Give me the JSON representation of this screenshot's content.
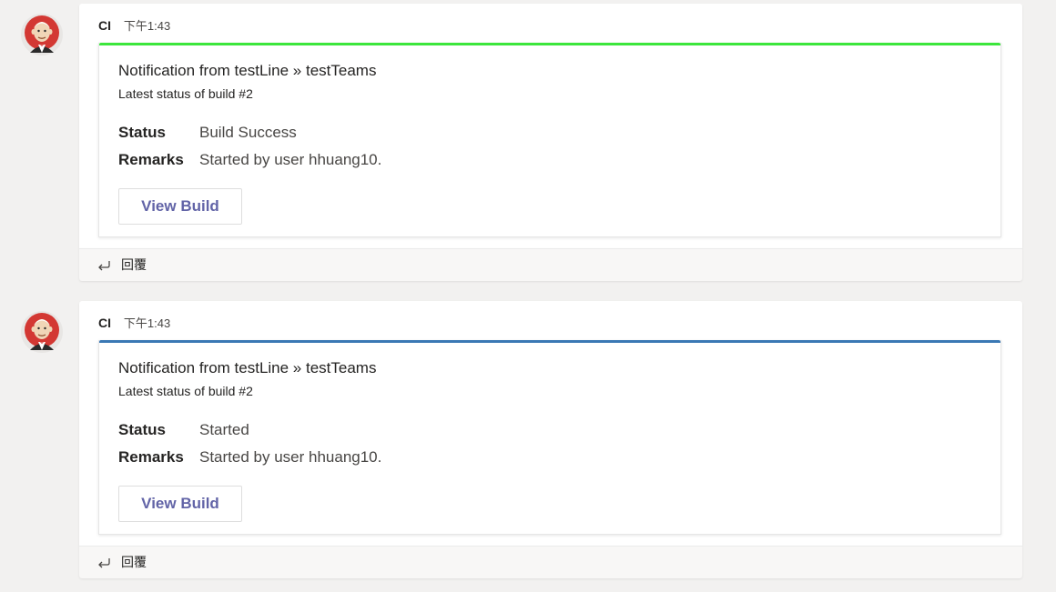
{
  "colors": {
    "success_accent": "#3ce63c",
    "started_accent": "#3a78b4",
    "button_text": "#6264a7"
  },
  "messages": [
    {
      "sender": "CI",
      "time": "下午1:43",
      "accent_color": "#3ce63c",
      "card": {
        "title": "Notification from testLine » testTeams",
        "subtitle": "Latest status of build #2",
        "facts": [
          {
            "label": "Status",
            "value": "Build Success"
          },
          {
            "label": "Remarks",
            "value": "Started by user hhuang10."
          }
        ],
        "button_label": "View Build"
      },
      "reply_label": "回覆",
      "avatar_icon": "jenkins-butler-icon",
      "reply_icon": "reply-arrow-icon"
    },
    {
      "sender": "CI",
      "time": "下午1:43",
      "accent_color": "#3a78b4",
      "card": {
        "title": "Notification from testLine » testTeams",
        "subtitle": "Latest status of build #2",
        "facts": [
          {
            "label": "Status",
            "value": "Started"
          },
          {
            "label": "Remarks",
            "value": "Started by user hhuang10."
          }
        ],
        "button_label": "View Build"
      },
      "reply_label": "回覆",
      "avatar_icon": "jenkins-butler-icon",
      "reply_icon": "reply-arrow-icon"
    }
  ]
}
